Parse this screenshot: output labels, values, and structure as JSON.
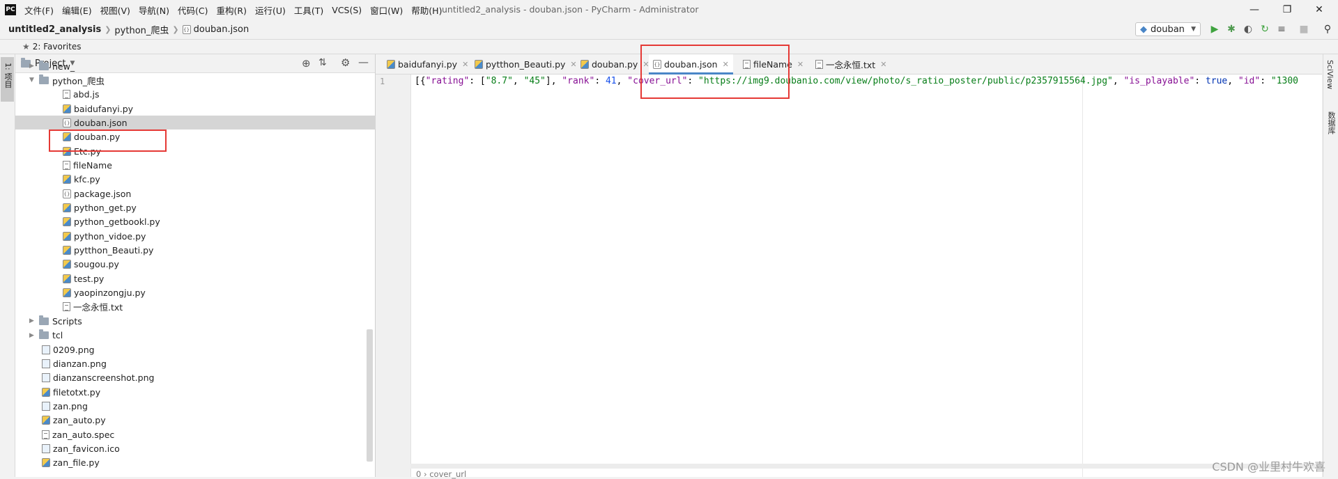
{
  "app": {
    "logo": "PC",
    "menu": [
      "文件(F)",
      "编辑(E)",
      "视图(V)",
      "导航(N)",
      "代码(C)",
      "重构(R)",
      "运行(U)",
      "工具(T)",
      "VCS(S)",
      "窗口(W)",
      "帮助(H)"
    ],
    "window_title": "untitled2_analysis - douban.json - PyCharm - Administrator"
  },
  "breadcrumb": [
    "untitled2_analysis",
    "python_爬虫",
    "douban.json"
  ],
  "run_config": "douban",
  "favorites_label": "2: Favorites",
  "left_stripe_label": "1: 项目",
  "project_panel": {
    "title": "Project",
    "tree": [
      {
        "label": "new_",
        "type": "folder",
        "depth": 1,
        "arrow": "▶"
      },
      {
        "label": "python_爬虫",
        "type": "folder",
        "depth": 1,
        "arrow": "▼"
      },
      {
        "label": "abd.js",
        "type": "txt",
        "depth": 2
      },
      {
        "label": "baidufanyi.py",
        "type": "py",
        "depth": 2
      },
      {
        "label": "douban.json",
        "type": "json",
        "depth": 2,
        "selected": true
      },
      {
        "label": "douban.py",
        "type": "py",
        "depth": 2
      },
      {
        "label": "Etc.py",
        "type": "py",
        "depth": 2
      },
      {
        "label": "fileName",
        "type": "txt",
        "depth": 2
      },
      {
        "label": "kfc.py",
        "type": "py",
        "depth": 2
      },
      {
        "label": "package.json",
        "type": "json",
        "depth": 2
      },
      {
        "label": "python_get.py",
        "type": "py",
        "depth": 2
      },
      {
        "label": "python_getbookl.py",
        "type": "py",
        "depth": 2
      },
      {
        "label": "python_vidoe.py",
        "type": "py",
        "depth": 2
      },
      {
        "label": "pytthon_Beauti.py",
        "type": "py",
        "depth": 2
      },
      {
        "label": "sougou.py",
        "type": "py",
        "depth": 2
      },
      {
        "label": "test.py",
        "type": "py",
        "depth": 2
      },
      {
        "label": "yaopinzongju.py",
        "type": "py",
        "depth": 2
      },
      {
        "label": "一念永恒.txt",
        "type": "txt",
        "depth": 2
      },
      {
        "label": "Scripts",
        "type": "folder",
        "depth": 1,
        "arrow": "▶"
      },
      {
        "label": "tcl",
        "type": "folder",
        "depth": 1,
        "arrow": "▶"
      },
      {
        "label": "0209.png",
        "type": "img",
        "depth": 1
      },
      {
        "label": "dianzan.png",
        "type": "img",
        "depth": 1
      },
      {
        "label": "dianzanscreenshot.png",
        "type": "img",
        "depth": 1
      },
      {
        "label": "filetotxt.py",
        "type": "py",
        "depth": 1
      },
      {
        "label": "zan.png",
        "type": "img",
        "depth": 1
      },
      {
        "label": "zan_auto.py",
        "type": "py",
        "depth": 1
      },
      {
        "label": "zan_auto.spec",
        "type": "txt",
        "depth": 1
      },
      {
        "label": "zan_favicon.ico",
        "type": "img",
        "depth": 1
      },
      {
        "label": "zan_file.py",
        "type": "py",
        "depth": 1
      }
    ]
  },
  "editor": {
    "tabs": [
      {
        "label": "baidufanyi.py",
        "type": "py"
      },
      {
        "label": "pytthon_Beauti.py",
        "type": "py"
      },
      {
        "label": "douban.py",
        "type": "py"
      },
      {
        "label": "douban.json",
        "type": "json",
        "active": true
      },
      {
        "label": "fileName",
        "type": "txt"
      },
      {
        "label": "一念永恒.txt",
        "type": "txt"
      }
    ],
    "line_number": "1",
    "code_tokens": [
      {
        "t": "[{",
        "c": "p"
      },
      {
        "t": "\"rating\"",
        "c": "key"
      },
      {
        "t": ": [",
        "c": "p"
      },
      {
        "t": "\"8.7\"",
        "c": "str"
      },
      {
        "t": ", ",
        "c": "p"
      },
      {
        "t": "\"45\"",
        "c": "str"
      },
      {
        "t": "], ",
        "c": "p"
      },
      {
        "t": "\"rank\"",
        "c": "key"
      },
      {
        "t": ": ",
        "c": "p"
      },
      {
        "t": "41",
        "c": "num"
      },
      {
        "t": ", ",
        "c": "p"
      },
      {
        "t": "\"cover_url\"",
        "c": "key"
      },
      {
        "t": ": ",
        "c": "p"
      },
      {
        "t": "\"https://img9.doubanio.com/view/photo/s_ratio_poster/public/p2357915564.jpg\"",
        "c": "str"
      },
      {
        "t": ", ",
        "c": "p"
      },
      {
        "t": "\"is_playable\"",
        "c": "key"
      },
      {
        "t": ": ",
        "c": "p"
      },
      {
        "t": "true",
        "c": "kw"
      },
      {
        "t": ", ",
        "c": "p"
      },
      {
        "t": "\"id\"",
        "c": "key"
      },
      {
        "t": ": ",
        "c": "p"
      },
      {
        "t": "\"1300",
        "c": "str"
      }
    ],
    "status_crumbs": "0  ›  cover_url"
  },
  "right_stripe": [
    "SciView",
    "数据库"
  ],
  "watermark": "CSDN @业里村牛欢喜"
}
